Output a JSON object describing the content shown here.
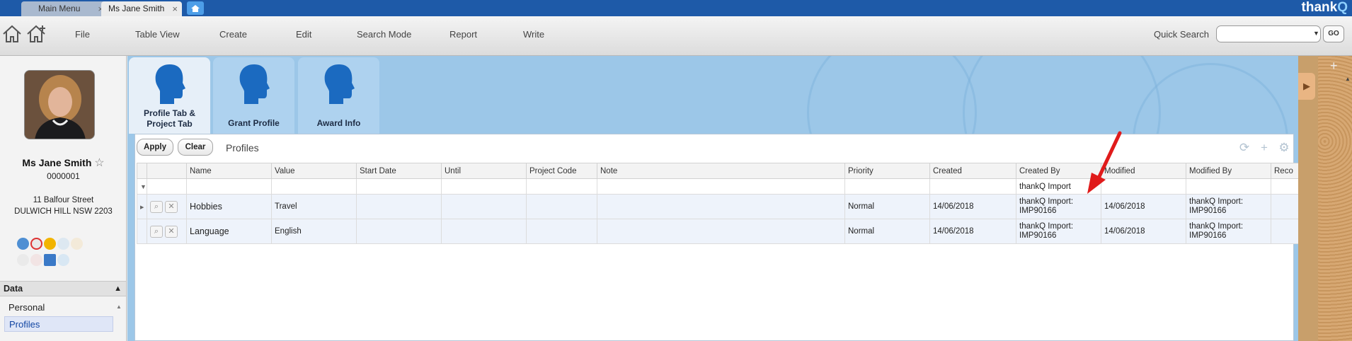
{
  "window_tabs": [
    {
      "label": "Main Menu",
      "active": false
    },
    {
      "label": "Ms Jane Smith",
      "active": true
    }
  ],
  "brand": {
    "main": "thank",
    "accent": "Q"
  },
  "toolbar": {
    "menus": [
      "File",
      "Table View",
      "Create",
      "Edit",
      "Search Mode",
      "Report",
      "Write"
    ],
    "quick_search_label": "Quick Search",
    "quick_search_value": "",
    "go_label": "GO"
  },
  "contact": {
    "name": "Ms Jane Smith",
    "id": "0000001",
    "address_line1": "11 Balfour Street",
    "address_line2": "DULWICH HILL NSW 2203"
  },
  "sidebar": {
    "section_title": "Data",
    "items": [
      {
        "label": "Personal",
        "selected": false
      },
      {
        "label": "Profiles",
        "selected": true
      }
    ]
  },
  "profile_tabs": [
    {
      "label": "Profile Tab & Project Tab",
      "active": true
    },
    {
      "label": "Grant Profile",
      "active": false
    },
    {
      "label": "Award Info",
      "active": false
    }
  ],
  "panel": {
    "apply_label": "Apply",
    "clear_label": "Clear",
    "title": "Profiles"
  },
  "grid": {
    "columns": [
      "Name",
      "Value",
      "Start Date",
      "Until",
      "Project Code",
      "Note",
      "Priority",
      "Created",
      "Created By",
      "Modified",
      "Modified By",
      "Reco"
    ],
    "filter_created_by": "thankQ Import",
    "rows": [
      {
        "name": "Hobbies",
        "value": "Travel",
        "start_date": "",
        "until": "",
        "project_code": "",
        "note": "",
        "priority": "Normal",
        "created": "14/06/2018",
        "created_by_1": "thankQ Import:",
        "created_by_2": "IMP90166",
        "modified": "14/06/2018",
        "modified_by_1": "thankQ Import:",
        "modified_by_2": "IMP90166"
      },
      {
        "name": "Language",
        "value": "English",
        "start_date": "",
        "until": "",
        "project_code": "",
        "note": "",
        "priority": "Normal",
        "created": "14/06/2018",
        "created_by_1": "thankQ Import:",
        "created_by_2": "IMP90166",
        "modified": "14/06/2018",
        "modified_by_1": "thankQ Import:",
        "modified_by_2": "IMP90166"
      }
    ]
  },
  "colors": {
    "title_bar": "#1e5aa8",
    "main_bg": "#9cc7e8",
    "annotation_arrow": "#e01b1b"
  }
}
